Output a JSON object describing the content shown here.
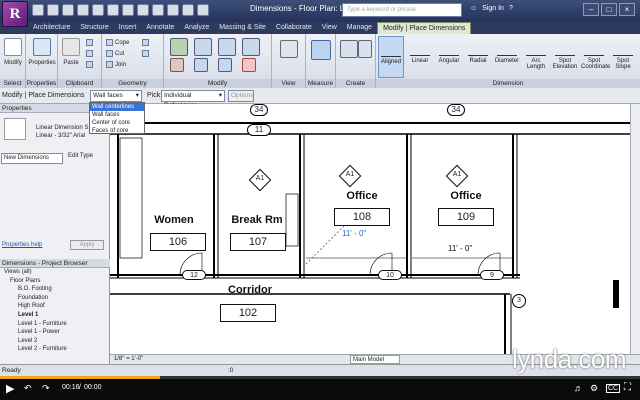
{
  "app": {
    "logo": "R",
    "title": "Dimensions - Floor Plan: Level 1",
    "search_placeholder": "Type a keyword or phrase",
    "sign_in": "Sign In",
    "help": "?"
  },
  "tabs": [
    "Architecture",
    "Structure",
    "Insert",
    "Annotate",
    "Analyze",
    "Massing & Site",
    "Collaborate",
    "View",
    "Manage",
    "Modify | Place Dimensions"
  ],
  "ribbon": {
    "select_group": {
      "label": "Select",
      "modify": "Modify"
    },
    "properties_group": {
      "label": "Properties",
      "properties": "Properties"
    },
    "clipboard_group": {
      "label": "Clipboard",
      "paste": "Paste"
    },
    "geometry_group": {
      "label": "Geometry",
      "cope": "Cope",
      "cut": "Cut",
      "join": "Join"
    },
    "modify_group": {
      "label": "Modify"
    },
    "view_group": {
      "label": "View"
    },
    "measure_group": {
      "label": "Measure"
    },
    "create_group": {
      "label": "Create"
    },
    "dimension_group": {
      "label": "Dimension",
      "tools": [
        "Aligned",
        "Linear",
        "Angular",
        "Radial",
        "Diameter",
        "Arc Length",
        "Spot Elevation",
        "Spot Coordinate",
        "Spot Slope"
      ]
    }
  },
  "options_bar": {
    "context": "Modify | Place Dimensions",
    "ref_value": "Wall faces",
    "pick_label": "Pick:",
    "pick_value": "Individual References",
    "options_button": "Options"
  },
  "dropdown_options": [
    "Wall centerlines",
    "Wall faces",
    "Center of core",
    "Faces of core"
  ],
  "properties": {
    "title": "Properties",
    "type_line1": "Linear Dimension S",
    "type_line2": "Linear - 3/32\" Arial",
    "filter": "New Dimensions",
    "edit_type": "Edit Type",
    "help_link": "Properties help",
    "apply": "Apply"
  },
  "project_browser": {
    "title": "Dimensions - Project Browser",
    "items": [
      "Views (all)",
      "Floor Plans",
      "B.O. Footing",
      "Foundation",
      "High Roof",
      "Level 1",
      "Level 1 - Furniture",
      "Level 1 - Power",
      "Level 2",
      "Level 2 - Furniture"
    ]
  },
  "drawing": {
    "rooms": [
      {
        "name": "Women",
        "number": "106"
      },
      {
        "name": "Break Rm",
        "number": "107"
      },
      {
        "name": "Office",
        "number": "108",
        "dim": "11' - 0\""
      },
      {
        "name": "Office",
        "number": "109",
        "dim": "11' - 0\""
      },
      {
        "name": "Corridor",
        "number": "102"
      }
    ],
    "tags": [
      "A1",
      "A1",
      "A1",
      "A1"
    ],
    "grid_bubbles": [
      "34",
      "34",
      "11"
    ],
    "door_tags": [
      "12",
      "10",
      "9",
      "3"
    ]
  },
  "view_control": {
    "scale": "1/8\" = 1'-0\"",
    "model": "Main Model"
  },
  "status": {
    "text": "Ready",
    "value": ":0"
  },
  "player": {
    "time_current": "00:16",
    "time_total": "00:00",
    "progress_pct": 25,
    "watermark": "lynda.com"
  },
  "colors": {
    "accent_title": "#24325a",
    "ribbon_tab_active": "#dfe8d2",
    "progress": "#f3a21b",
    "selected_tool": "#c4d9f2"
  }
}
